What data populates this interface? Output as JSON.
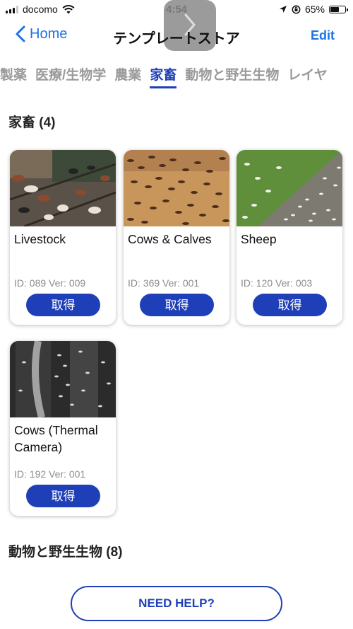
{
  "status_bar": {
    "carrier": "docomo",
    "time": "4:54",
    "battery_percent": "65%",
    "battery_level": 0.65
  },
  "nav": {
    "back_label": "Home",
    "title": "テンプレートストア",
    "edit_label": "Edit"
  },
  "tabs": [
    {
      "label": "製薬",
      "active": false
    },
    {
      "label": "医療/生物学",
      "active": false
    },
    {
      "label": "農業",
      "active": false
    },
    {
      "label": "家畜",
      "active": true
    },
    {
      "label": "動物と野生生物",
      "active": false
    },
    {
      "label": "レイヤ",
      "active": false
    }
  ],
  "sections": [
    {
      "title": "家畜 (4)",
      "cards": [
        {
          "name": "Livestock",
          "meta": "ID: 089 Ver: 009",
          "button": "取得",
          "image": "livestock-pen-photo"
        },
        {
          "name": "Cows & Calves",
          "meta": "ID: 369 Ver: 001",
          "button": "取得",
          "image": "cows-aerial-photo"
        },
        {
          "name": "Sheep",
          "meta": "ID: 120 Ver: 003",
          "button": "取得",
          "image": "sheep-aerial-photo"
        },
        {
          "name": "Cows (Thermal Camera)",
          "meta": "ID: 192 Ver: 001",
          "button": "取得",
          "image": "thermal-cows-photo"
        }
      ]
    },
    {
      "title": "動物と野生生物 (8)"
    }
  ],
  "help_button": "NEED HELP?",
  "colors": {
    "accent": "#1f3fb8",
    "link": "#1a73e8",
    "inactive_tab": "#9a9a9a"
  }
}
